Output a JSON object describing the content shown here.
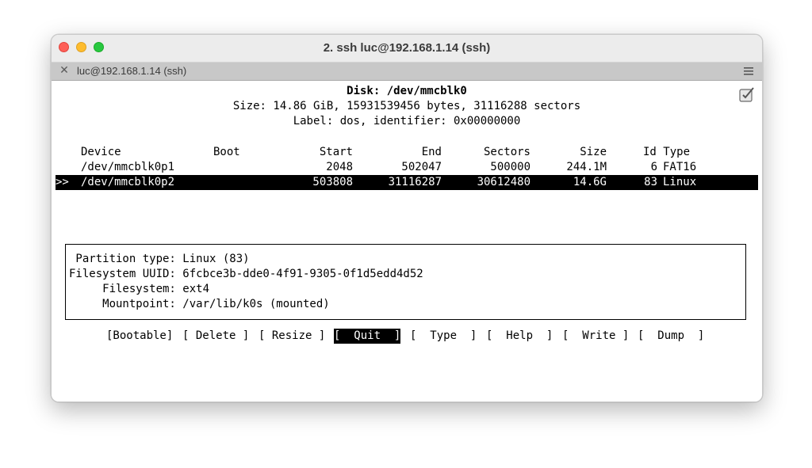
{
  "window": {
    "title": "2. ssh luc@192.168.1.14 (ssh)",
    "tab_title": "luc@192.168.1.14 (ssh)"
  },
  "disk": {
    "header": "Disk: /dev/mmcblk0",
    "size_line": "Size: 14.86 GiB, 15931539456 bytes, 31116288 sectors",
    "label_line": "Label: dos, identifier: 0x00000000"
  },
  "table": {
    "headers": {
      "device": "Device",
      "boot": "Boot",
      "start": "Start",
      "end": "End",
      "sectors": "Sectors",
      "size": "Size",
      "id_type": "Id Type"
    },
    "rows": [
      {
        "marker": "",
        "device": "/dev/mmcblk0p1",
        "boot": "",
        "start": "2048",
        "end": "502047",
        "sectors": "500000",
        "size": "244.1M",
        "id": "6",
        "type": "FAT16"
      },
      {
        "marker": ">>",
        "device": "/dev/mmcblk0p2",
        "boot": "",
        "start": "503808",
        "end": "31116287",
        "sectors": "30612480",
        "size": "14.6G",
        "id": "83",
        "type": "Linux"
      }
    ]
  },
  "partition_info": {
    "lines": [
      " Partition type: Linux (83)",
      "Filesystem UUID: 6fcbce3b-dde0-4f91-9305-0f1d5edd4d52",
      "     Filesystem: ext4",
      "     Mountpoint: /var/lib/k0s (mounted)"
    ]
  },
  "menu": {
    "items": [
      "[Bootable]",
      "[ Delete ]",
      "[ Resize ]",
      "[  Quit  ]",
      "[  Type  ]",
      "[  Help  ]",
      "[  Write ]",
      "[  Dump  ]"
    ],
    "selected_index": 3
  },
  "icons": {
    "tab_close": "close-icon",
    "tab_menu": "hamburger-menu-icon",
    "scroll": "edit-checkbox-icon"
  },
  "colors": {
    "traffic_close": "#fe5f57",
    "traffic_min": "#febc2e",
    "traffic_max": "#28c840",
    "selection_bg": "#000000",
    "selection_fg": "#ffffff"
  }
}
